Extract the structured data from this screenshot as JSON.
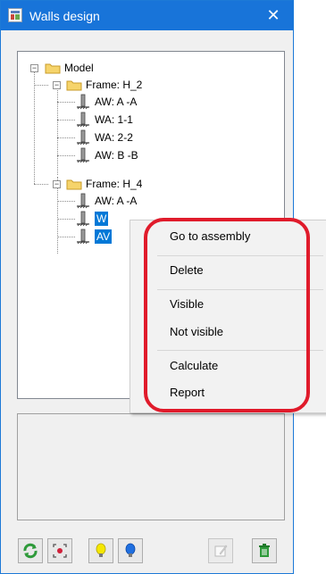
{
  "window": {
    "title": "Walls design",
    "close_symbol": "✕"
  },
  "tree": {
    "root_label": "Model",
    "frames": [
      {
        "label": "Frame: H_2",
        "items": [
          "AW: A -A",
          "WA: 1-1",
          "WA: 2-2",
          "AW: B -B"
        ]
      },
      {
        "label": "Frame: H_4",
        "items": [
          "AW: A -A",
          "W",
          "AV"
        ]
      }
    ],
    "expander_collapse_symbol": "−"
  },
  "context_menu": {
    "items": [
      {
        "label": "Go to assembly"
      },
      {
        "label": "Delete"
      },
      {
        "label": "Visible"
      },
      {
        "label": "Not visible"
      },
      {
        "label": "Calculate"
      },
      {
        "label": "Report"
      }
    ]
  },
  "toolbar": {
    "buttons": [
      {
        "icon": "refresh-icon"
      },
      {
        "icon": "focus-target-icon"
      },
      {
        "icon": "yellow-bulb-icon"
      },
      {
        "icon": "blue-bulb-icon"
      },
      {
        "icon": "edit-icon"
      },
      {
        "icon": "trash-icon"
      }
    ]
  },
  "colors": {
    "titlebar": "#1874d9",
    "selection": "#0078d7",
    "highlight_oval": "#e01b2b",
    "folder": "#f6d46b"
  }
}
